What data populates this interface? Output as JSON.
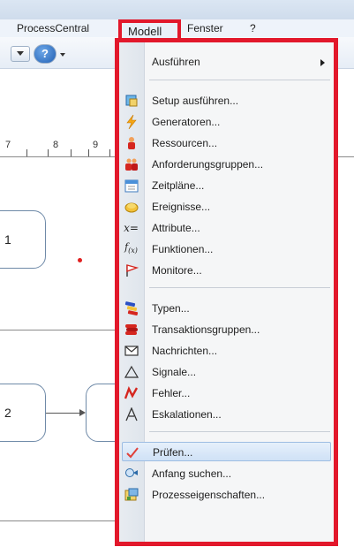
{
  "menubar": {
    "items": [
      "ProcessCentral",
      "Modell",
      "Fenster",
      "?"
    ]
  },
  "ruler": {
    "ticks": [
      "7",
      "8",
      "9"
    ]
  },
  "canvas": {
    "tasks": [
      "1",
      "2"
    ]
  },
  "menu": {
    "title": "Modell",
    "items": [
      {
        "label": "Ausführen",
        "icon": "none",
        "submenu": true
      },
      {
        "label": "Setup ausführen...",
        "icon": "setup-icon"
      },
      {
        "label": "Generatoren...",
        "icon": "lightning-icon"
      },
      {
        "label": "Ressourcen...",
        "icon": "person-icon"
      },
      {
        "label": "Anforderungsgruppen...",
        "icon": "group-icon"
      },
      {
        "label": "Zeitpläne...",
        "icon": "calendar-icon"
      },
      {
        "label": "Ereignisse...",
        "icon": "event-icon"
      },
      {
        "label": "Attribute...",
        "icon": "variable-icon"
      },
      {
        "label": "Funktionen...",
        "icon": "function-icon"
      },
      {
        "label": "Monitore...",
        "icon": "flag-icon"
      },
      {
        "label": "Typen...",
        "icon": "types-icon"
      },
      {
        "label": "Transaktionsgruppen...",
        "icon": "transaction-icon"
      },
      {
        "label": "Nachrichten...",
        "icon": "envelope-icon"
      },
      {
        "label": "Signale...",
        "icon": "triangle-icon"
      },
      {
        "label": "Fehler...",
        "icon": "error-bolt-icon"
      },
      {
        "label": "Eskalationen...",
        "icon": "escalation-icon"
      },
      {
        "label": "Prüfen...",
        "icon": "checkmark-icon",
        "highlighted": true
      },
      {
        "label": "Anfang suchen...",
        "icon": "find-start-icon"
      },
      {
        "label": "Prozesseigenschaften...",
        "icon": "properties-icon"
      }
    ]
  },
  "colors": {
    "highlight_border": "#e2182b",
    "selection": "#cfe1f6",
    "task_border": "#6f8aa8"
  }
}
